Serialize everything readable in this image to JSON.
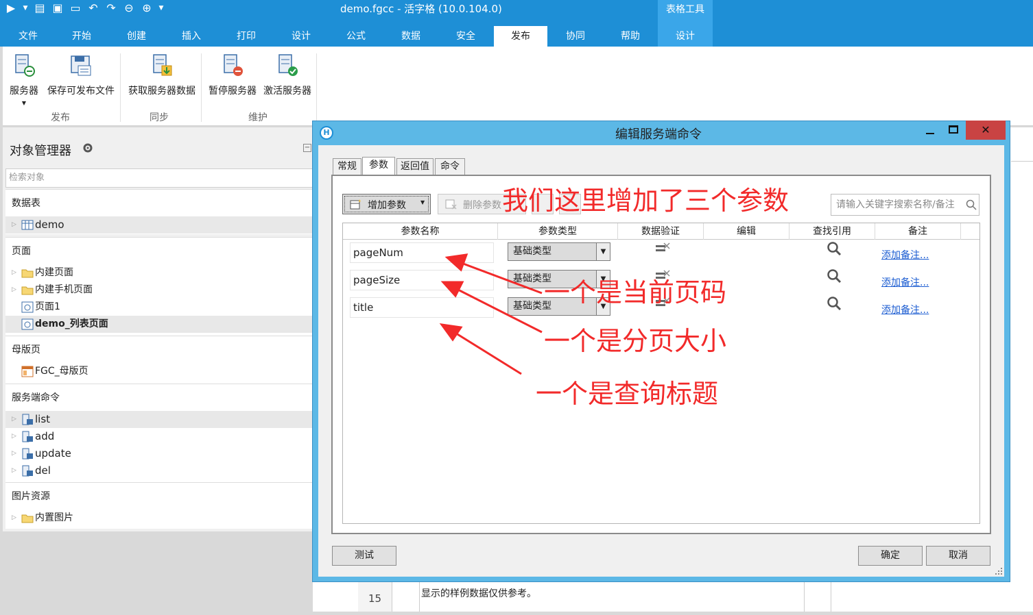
{
  "window": {
    "title": "demo.fgcc - 活字格 (10.0.104.0)",
    "tools_tab": "表格工具"
  },
  "tabs": [
    "文件",
    "开始",
    "创建",
    "插入",
    "打印",
    "设计",
    "公式",
    "数据",
    "安全",
    "发布",
    "协同",
    "帮助",
    "设计"
  ],
  "active_tab": "发布",
  "ribbon": {
    "buttons": {
      "server": "服务器",
      "save_publishable": "保存可发布文件",
      "fetch_server_data": "获取服务器数据",
      "pause_server": "暂停服务器",
      "activate_server": "激活服务器"
    },
    "groups": {
      "publish": "发布",
      "sync": "同步",
      "maintain": "维护"
    }
  },
  "object_manager": {
    "title": "对象管理器",
    "search_placeholder": "检索对象",
    "sections": {
      "tables": "数据表",
      "pages": "页面",
      "master_pages": "母版页",
      "server_commands": "服务端命令",
      "images": "图片资源"
    },
    "items": {
      "demo": "demo",
      "builtin_pages": "内建页面",
      "builtin_mobile_pages": "内建手机页面",
      "page1": "页面1",
      "demo_list_page": "demo_列表页面",
      "master": "FGC_母版页",
      "cmd_list": "list",
      "cmd_add": "add",
      "cmd_update": "update",
      "cmd_del": "del",
      "builtin_images": "内置图片"
    }
  },
  "sheet": {
    "row_number": "15",
    "text": "显示的样例数据仅供参考。"
  },
  "dialog": {
    "title": "编辑服务端命令",
    "tabs": [
      "常规",
      "参数",
      "返回值",
      "命令"
    ],
    "active_tab": "参数",
    "toolbar": {
      "add_param": "增加参数",
      "delete_param": "删除参数",
      "search_placeholder": "请输入关键字搜索名称/备注"
    },
    "columns": [
      "参数名称",
      "参数类型",
      "数据验证",
      "编辑",
      "查找引用",
      "备注"
    ],
    "rows": [
      {
        "name": "pageNum",
        "type": "基础类型",
        "note": "添加备注..."
      },
      {
        "name": "pageSize",
        "type": "基础类型",
        "note": "添加备注..."
      },
      {
        "name": "title",
        "type": "基础类型",
        "note": "添加备注..."
      }
    ],
    "buttons": {
      "test": "测试",
      "ok": "确定",
      "cancel": "取消"
    }
  },
  "annotations": {
    "headline": "我们这里增加了三个参数",
    "note_page_num": "一个是当前页码",
    "note_page_size": "一个是分页大小",
    "note_title": "一个是查询标题",
    "color": "#f22a2a"
  }
}
